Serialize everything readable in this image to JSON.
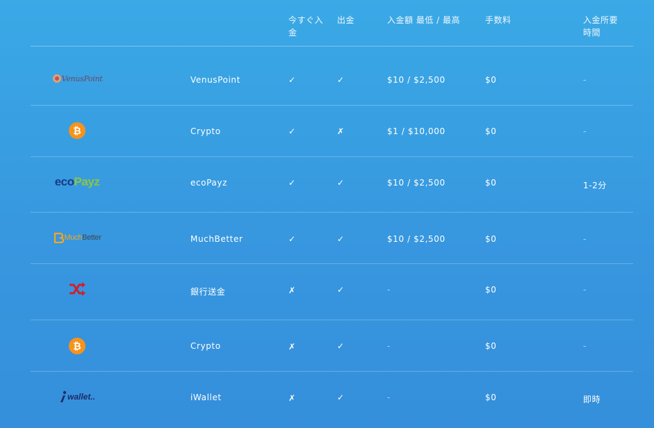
{
  "header": {
    "instant": "今すぐ入金",
    "withdraw": "出金",
    "amount": "入金額 最低 / 最高",
    "fee": "手数料",
    "time": "入金所要時間"
  },
  "marks": {
    "yes": "✓",
    "no": "✗"
  },
  "rows": [
    {
      "logo": "VenusPoint",
      "name": "VenusPoint",
      "instant": "✓",
      "withdraw": "✓",
      "amount": "$10 / $2,500",
      "fee": "$0",
      "time": "-"
    },
    {
      "logo": "bitcoin-icon",
      "name": "Crypto",
      "instant": "✓",
      "withdraw": "✗",
      "amount": "$1 / $10,000",
      "fee": "$0",
      "time": "-"
    },
    {
      "logo": "ecoPayz",
      "logo_parts": [
        "eco",
        "Payz"
      ],
      "name": "ecoPayz",
      "instant": "✓",
      "withdraw": "✓",
      "amount": "$10 / $2,500",
      "fee": "$0",
      "time": "1-2分"
    },
    {
      "logo": "MuchBetter",
      "logo_parts": [
        "Much",
        "Better"
      ],
      "name": "MuchBetter",
      "instant": "✓",
      "withdraw": "✓",
      "amount": "$10 / $2,500",
      "fee": "$0",
      "time": "-"
    },
    {
      "logo": "shuffle-icon",
      "name": "銀行送金",
      "instant": "✗",
      "withdraw": "✓",
      "amount": "-",
      "fee": "$0",
      "time": "-"
    },
    {
      "logo": "bitcoin-icon",
      "name": "Crypto",
      "instant": "✗",
      "withdraw": "✓",
      "amount": "-",
      "fee": "$0",
      "time": "-"
    },
    {
      "logo": "wallet..",
      "name": "iWallet",
      "instant": "✗",
      "withdraw": "✓",
      "amount": "-",
      "fee": "$0",
      "time": "即時"
    }
  ],
  "colors": {
    "bitcoin": "#f7931a",
    "eco_dark": "#1a3b86",
    "eco_green": "#8cc63f",
    "muchbetter_orange": "#f5a623",
    "shuffle_red": "#d0202f",
    "venus": "#6b4a63",
    "iwallet": "#1e2c66"
  }
}
